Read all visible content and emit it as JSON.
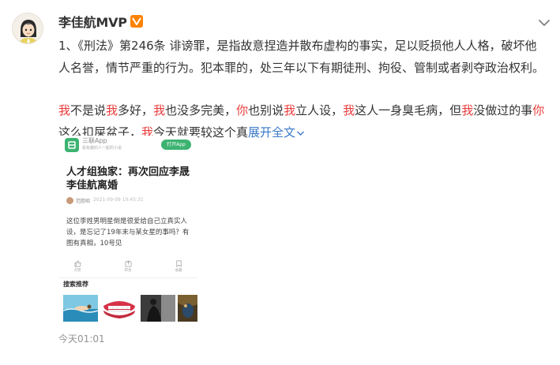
{
  "post": {
    "username": "李佳航MVP",
    "badge": "V",
    "paragraph1": "1、《刑法》第246条 诽谤罪，是指故意捏造并散布虚构的事实，足以贬损他人人格，破坏他人名誉，情节严重的行为。犯本罪的，处三年以下有期徒刑、拘役、管制或者剥夺政治权利。",
    "paragraph2_segments": [
      {
        "text": "我",
        "hl": true
      },
      {
        "text": "不是说",
        "hl": false
      },
      {
        "text": "我",
        "hl": true
      },
      {
        "text": "多好，",
        "hl": false
      },
      {
        "text": "我",
        "hl": true
      },
      {
        "text": "也没多完美，",
        "hl": false
      },
      {
        "text": "你",
        "hl": true
      },
      {
        "text": "也别说",
        "hl": false
      },
      {
        "text": "我",
        "hl": true
      },
      {
        "text": "立人设，",
        "hl": false
      },
      {
        "text": "我",
        "hl": true
      },
      {
        "text": "这人一身臭毛病，但",
        "hl": false
      },
      {
        "text": "我",
        "hl": true
      },
      {
        "text": "没做过的事",
        "hl": false
      },
      {
        "text": "你",
        "hl": true
      },
      {
        "text": "这么扣屎盆子，",
        "hl": false
      },
      {
        "text": "我",
        "hl": true
      },
      {
        "text": "今天就要较这个真",
        "hl": false
      }
    ],
    "expand_label": "展开全文",
    "timestamp": "今天01:01",
    "highlight_color": "#eb3b3b",
    "link_color": "#3a7ac8",
    "badge_color": "#ff8200"
  },
  "embedded": {
    "app_name": "三联App",
    "app_subtitle": "看有趣的人一起的小说",
    "open_app_label": "打开App",
    "title": "人才组独家：再次回应李晟李佳航离婚",
    "author": "范胜昭",
    "time": "2021-09-09 10:45:31",
    "body": "这位李姓男明星倒是很爱给自己立真实人设，是忘记了19年末与某女星的事吗？有图有真相，10号见",
    "actions": [
      {
        "icon": "thumb-up-icon",
        "label": "点赞"
      },
      {
        "icon": "share-icon",
        "label": "转发"
      },
      {
        "icon": "bookmark-icon",
        "label": "收藏"
      }
    ],
    "search_label": "搜索推荐",
    "accent_color": "#3cb371"
  }
}
